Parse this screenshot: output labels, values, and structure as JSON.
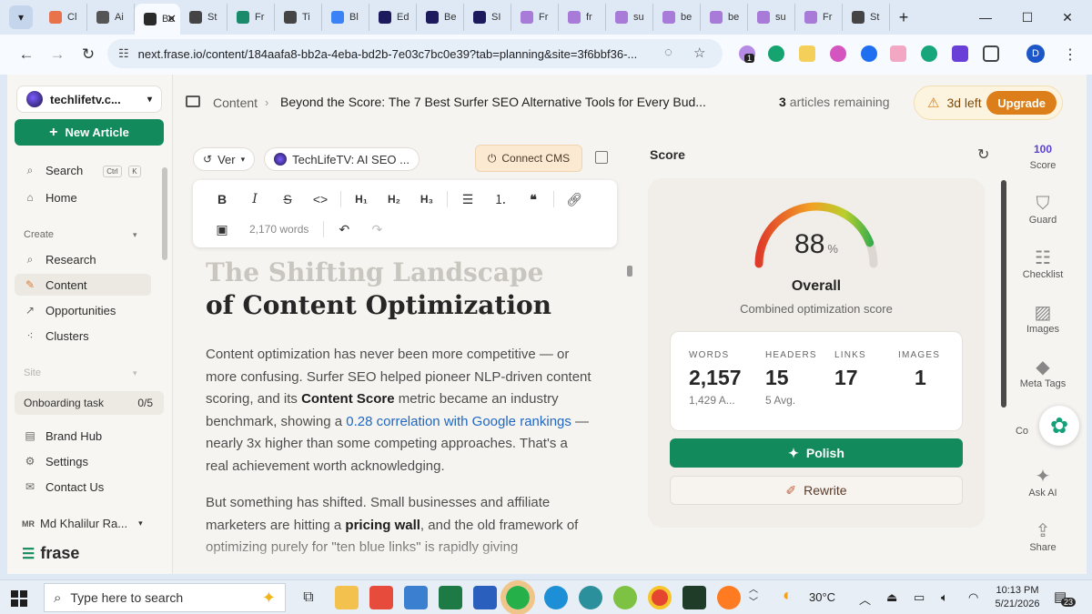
{
  "browser": {
    "tabs": [
      {
        "label": "Cl",
        "color": "#e8734a"
      },
      {
        "label": "Ai",
        "color": "#555555"
      },
      {
        "label": "Be",
        "color": "#2a2a2a",
        "active": true
      },
      {
        "label": "St",
        "color": "#444444"
      },
      {
        "label": "Fr",
        "color": "#1b8a6b"
      },
      {
        "label": "Ti",
        "color": "#444444"
      },
      {
        "label": "Bl",
        "color": "#3b82f6"
      },
      {
        "label": "Ed",
        "color": "#1c1a5c"
      },
      {
        "label": "Be",
        "color": "#1c1a5c"
      },
      {
        "label": "SI",
        "color": "#1c1a5c"
      },
      {
        "label": "Fr",
        "color": "#a97bd8"
      },
      {
        "label": "fr",
        "color": "#a97bd8"
      },
      {
        "label": "su",
        "color": "#a97bd8"
      },
      {
        "label": "be",
        "color": "#a97bd8"
      },
      {
        "label": "be",
        "color": "#a97bd8"
      },
      {
        "label": "su",
        "color": "#a97bd8"
      },
      {
        "label": "Fr",
        "color": "#a97bd8"
      },
      {
        "label": "St",
        "color": "#444444"
      }
    ],
    "url": "next.frase.io/content/184aafa8-bb2a-4eba-bd2b-7e03c7bc0e39?tab=planning&site=3f6bbf36-...",
    "profile_initial": "D",
    "extension_badge": "1"
  },
  "sidebar": {
    "workspace": "techlifetv.c...",
    "new_article": "New Article",
    "search": "Search",
    "search_kbd": [
      "Ctrl",
      "K"
    ],
    "home": "Home",
    "create_heading": "Create",
    "create_items": [
      "Research",
      "Content",
      "Opportunities",
      "Clusters"
    ],
    "site_heading": "Site",
    "onboarding_label": "Onboarding task",
    "onboarding_count": "0/5",
    "bottom_items": [
      "Brand Hub",
      "Settings",
      "Contact Us"
    ],
    "user_initials": "MR",
    "user_name": "Md Khalilur Ra...",
    "brand": "frase"
  },
  "header": {
    "crumb": "Content",
    "title": "Beyond the Score: The 7 Best Surfer SEO Alternative Tools for Every Bud...",
    "articles_count": "3",
    "articles_label": "articles remaining",
    "trial": "3d left",
    "upgrade": "Upgrade"
  },
  "editor": {
    "version": "Ver",
    "project": "TechLifeTV: AI SEO ...",
    "connect_cms": "Connect CMS",
    "word_count": "2,170 words",
    "heading_faded": "The Shifting Landscape",
    "heading": "of Content Optimization",
    "p1_a": "Content optimization has never been more competitive — or more confusing. Surfer SEO helped pioneer NLP-driven content scoring, and its ",
    "p1_b": "Content Score",
    "p1_c": " metric became an industry benchmark, showing a ",
    "p1_link": "0.28 correlation with Google rankings",
    "p1_d": " — nearly 3x higher than some competing approaches. That's a real achievement worth acknowledging.",
    "p2_a": "But something has shifted. Small businesses and affiliate marketers are hitting a ",
    "p2_b": "pricing wall",
    "p2_c": ", and the old framework of optimizing purely for \"ten blue links\" is rapidly giving"
  },
  "score": {
    "title": "Score",
    "value": 88,
    "value_text": "88",
    "unit": "%",
    "overall": "Overall",
    "subtitle": "Combined optimization score",
    "stats": [
      {
        "label": "WORDS",
        "value": "2,157",
        "sub": "1,429 A..."
      },
      {
        "label": "HEADERS",
        "value": "15",
        "sub": "5 Avg."
      },
      {
        "label": "LINKS",
        "value": "17",
        "sub": ""
      },
      {
        "label": "IMAGES",
        "value": "1",
        "sub": ""
      }
    ],
    "polish": "Polish",
    "rewrite": "Rewrite"
  },
  "rail": {
    "badge": "100",
    "items": [
      "Score",
      "Guard",
      "Checklist",
      "Images",
      "Meta Tags",
      "Co",
      "Ask AI",
      "Share"
    ]
  },
  "taskbar": {
    "search_placeholder": "Type here to search",
    "temperature": "30°C",
    "time": "10:13 PM",
    "date": "5/21/2026",
    "notifications": "23"
  }
}
